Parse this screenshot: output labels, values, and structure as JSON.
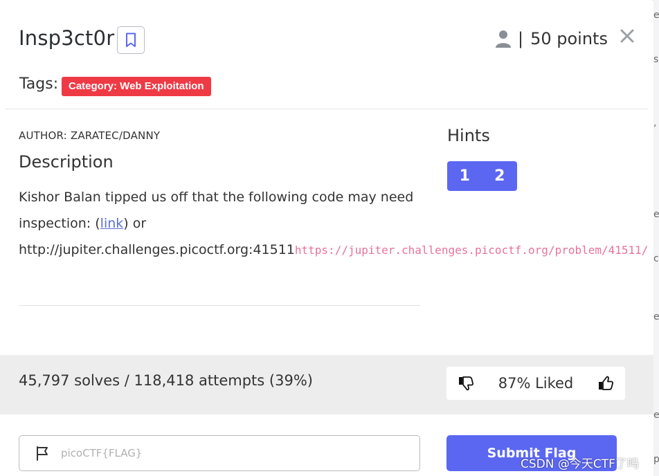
{
  "challenge": {
    "title": "Insp3ct0r",
    "points_text": "50 points"
  },
  "tags": {
    "label": "Tags:",
    "items": [
      "Category: Web Exploitation"
    ]
  },
  "author": "AUTHOR: ZARATEC/DANNY",
  "description": {
    "heading": "Description",
    "text_before_link": "Kishor Balan tipped us off that the following code may need inspection: (",
    "link_text": "link",
    "text_after_link": ") or http://jupiter.challenges.picoctf.org:41511",
    "code_url": "https://jupiter.challenges.picoctf.org/problem/41511/"
  },
  "hints": {
    "heading": "Hints",
    "buttons": [
      "1",
      "2"
    ]
  },
  "stats": {
    "solves_text": "45,797 solves / 118,418 attempts (39%)",
    "liked_text": "87% Liked"
  },
  "flag": {
    "placeholder": "picoCTF{FLAG}",
    "submit_label": "Submit Flag"
  },
  "watermark": "CSDN @今天CTF了吗",
  "colors": {
    "accent": "#5b67f1",
    "tag_red": "#ee3a45",
    "code_pink": "#e6729a"
  }
}
